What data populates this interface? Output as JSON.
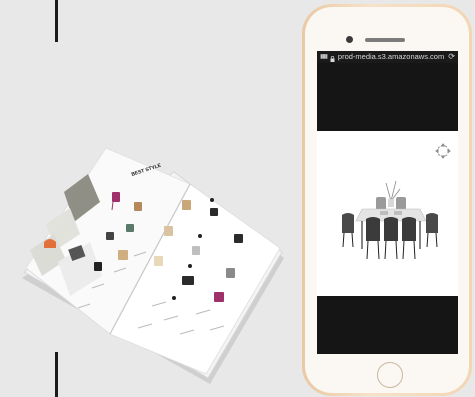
{
  "browser": {
    "url_text": "prod-media.s3.amazonaws.com"
  },
  "catalog": {
    "heading": "BEST STYLE"
  },
  "icons": {
    "lock": "lock-icon",
    "reload": "reload-icon",
    "expand": "expand-icon"
  },
  "colors": {
    "background": "#e8e8e8",
    "phone_frame": "#f2d6b4",
    "screen_dark": "#151515",
    "accent_orange": "#e2703a",
    "accent_magenta": "#a0306a"
  }
}
